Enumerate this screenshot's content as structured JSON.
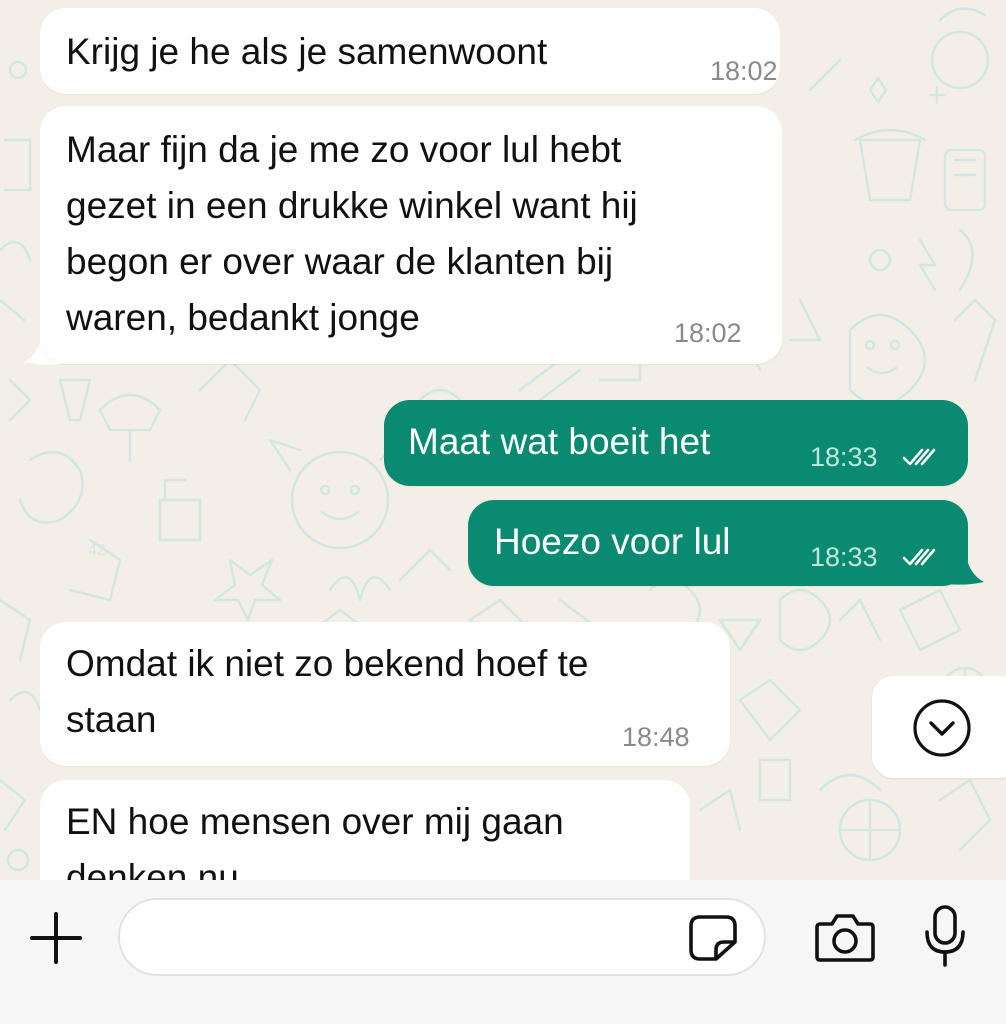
{
  "messages": [
    {
      "direction": "incoming",
      "text": "Krijg je he als je samenwoont",
      "time": "18:02"
    },
    {
      "direction": "incoming",
      "text": "Maar fijn da je me zo voor lul hebt\ngezet in een drukke winkel want hij\nbegon er over waar de klanten bij\nwaren, bedankt jonge",
      "time": "18:02"
    },
    {
      "direction": "outgoing",
      "text": "Maat wat boeit het",
      "time": "18:33",
      "status": "read"
    },
    {
      "direction": "outgoing",
      "text": "Hoezo voor lul",
      "time": "18:33",
      "status": "read"
    },
    {
      "direction": "incoming",
      "text": "Omdat ik niet zo bekend hoef te\nstaan",
      "time": "18:48"
    },
    {
      "direction": "incoming",
      "text": "EN hoe mensen over mij gaan\ndenken nu",
      "time": ""
    }
  ],
  "composer": {
    "placeholder": "",
    "value": ""
  },
  "icons": {
    "add": "plus-icon",
    "sticker": "sticker-icon",
    "camera": "camera-icon",
    "mic": "microphone-icon",
    "scroll": "chevron-down-circle-icon",
    "read_receipt": "double-check-icon"
  },
  "colors": {
    "outgoing_bubble": "#0a8a70",
    "incoming_bubble": "#ffffff",
    "wallpaper": "#f3efe7",
    "wallpaper_doodle": "#d3e7e1",
    "input_bar": "#f6f6f6"
  }
}
